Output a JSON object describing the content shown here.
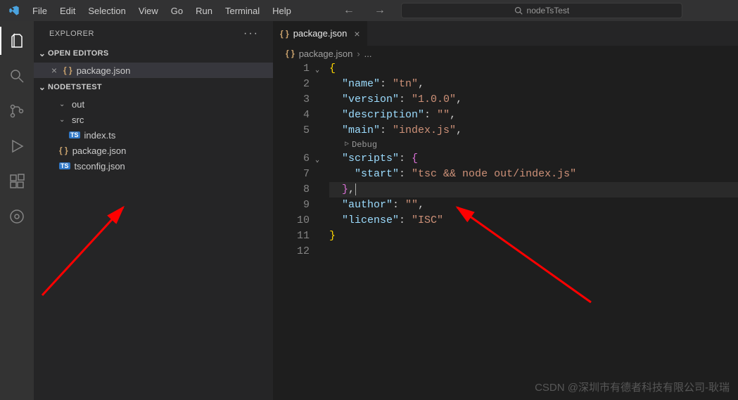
{
  "titlebar": {
    "menu": [
      "File",
      "Edit",
      "Selection",
      "View",
      "Go",
      "Run",
      "Terminal",
      "Help"
    ],
    "search_placeholder": "nodeTsTest"
  },
  "sidebar": {
    "title": "EXPLORER",
    "sections": {
      "open_editors": {
        "label": "OPEN EDITORS",
        "items": [
          {
            "icon": "braces",
            "name": "package.json",
            "active": true
          }
        ]
      },
      "workspace": {
        "label": "NODETSTEST",
        "tree": [
          {
            "type": "folder",
            "name": "out",
            "depth": 1
          },
          {
            "type": "folder",
            "name": "src",
            "depth": 1
          },
          {
            "type": "file",
            "name": "index.ts",
            "icon": "ts",
            "depth": 2
          },
          {
            "type": "file",
            "name": "package.json",
            "icon": "braces",
            "depth": 1
          },
          {
            "type": "file",
            "name": "tsconfig.json",
            "icon": "ts",
            "depth": 1
          }
        ]
      }
    }
  },
  "editor": {
    "tab": {
      "icon": "braces",
      "name": "package.json"
    },
    "breadcrumb": [
      {
        "icon": "braces",
        "text": "package.json"
      }
    ],
    "codelens": "Debug",
    "lines": [
      {
        "n": 1,
        "fold": "v",
        "html": "<span class='tok-brace'>{</span>"
      },
      {
        "n": 2,
        "html": "  <span class='tok-key'>\"name\"</span><span class='tok-punc'>: </span><span class='tok-str'>\"tn\"</span><span class='tok-punc'>,</span>"
      },
      {
        "n": 3,
        "html": "  <span class='tok-key'>\"version\"</span><span class='tok-punc'>: </span><span class='tok-str'>\"1.0.0\"</span><span class='tok-punc'>,</span>"
      },
      {
        "n": 4,
        "html": "  <span class='tok-key'>\"description\"</span><span class='tok-punc'>: </span><span class='tok-str'>\"\"</span><span class='tok-punc'>,</span>"
      },
      {
        "n": 5,
        "html": "  <span class='tok-key'>\"main\"</span><span class='tok-punc'>: </span><span class='tok-str'>\"index.js\"</span><span class='tok-punc'>,</span>"
      },
      {
        "n": 6,
        "fold": "v",
        "html": "  <span class='tok-key'>\"scripts\"</span><span class='tok-punc'>: </span><span class='tok-brace2'>{</span>"
      },
      {
        "n": 7,
        "html": "    <span class='tok-key'>\"start\"</span><span class='tok-punc'>: </span><span class='tok-str'>\"tsc && node out/index.js\"</span>"
      },
      {
        "n": 8,
        "cursor": true,
        "html": "  <span class='tok-brace2'>}</span><span class='tok-punc'>,</span>"
      },
      {
        "n": 9,
        "html": "  <span class='tok-key'>\"author\"</span><span class='tok-punc'>: </span><span class='tok-str'>\"\"</span><span class='tok-punc'>,</span>"
      },
      {
        "n": 10,
        "html": "  <span class='tok-key'>\"license\"</span><span class='tok-punc'>: </span><span class='tok-str'>\"ISC\"</span>"
      },
      {
        "n": 11,
        "html": "<span class='tok-brace'>}</span>"
      },
      {
        "n": 12,
        "html": ""
      }
    ]
  },
  "watermark": "CSDN @深圳市有德者科技有限公司-耿瑞"
}
